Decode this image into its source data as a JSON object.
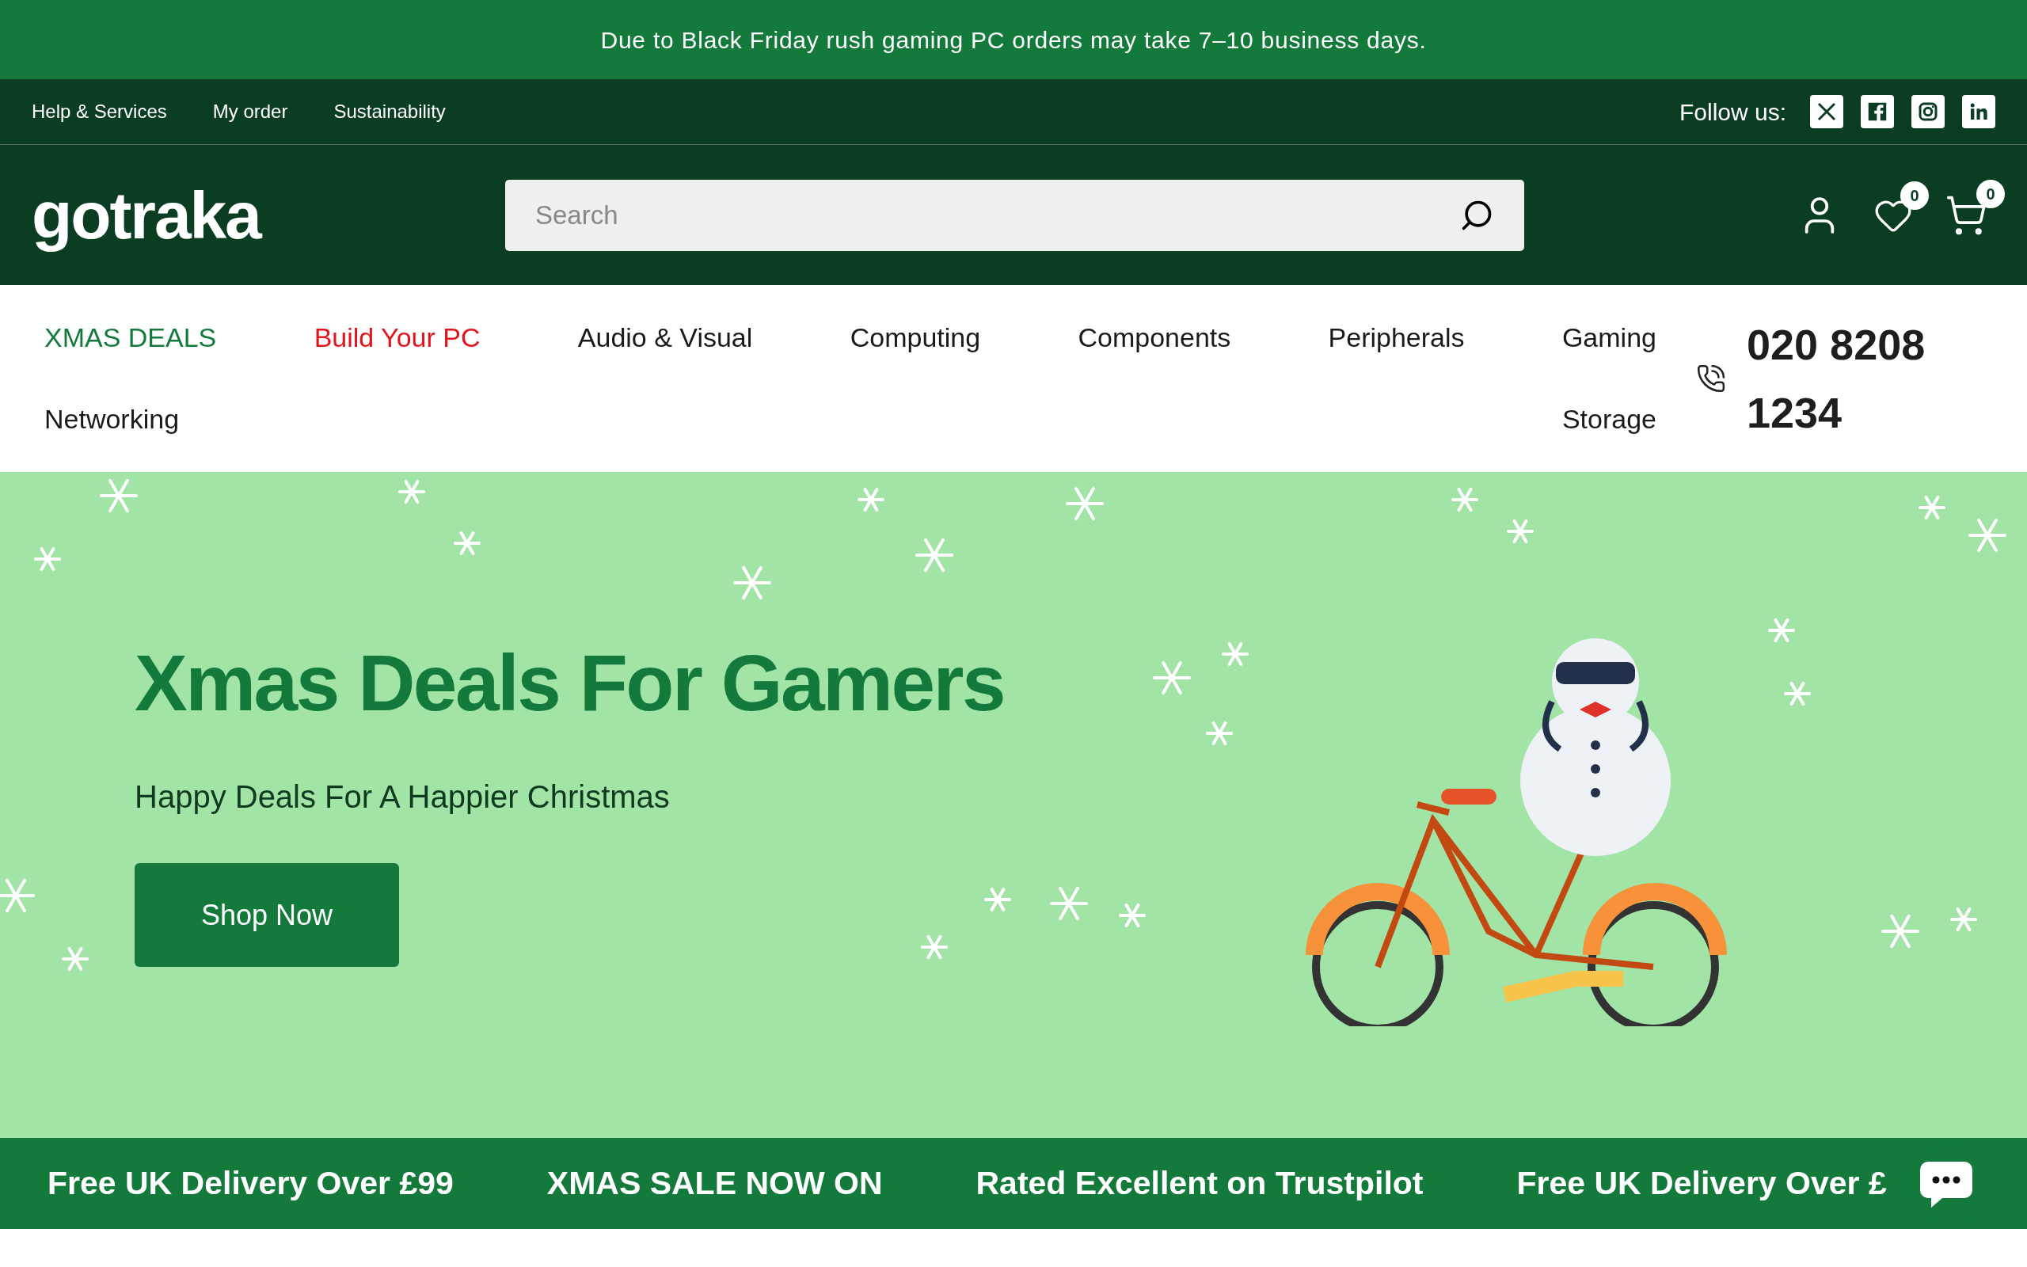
{
  "announcement": "Due to Black Friday rush gaming PC orders may take 7–10 business days.",
  "top_links": [
    "Help & Services",
    "My order",
    "Sustainability"
  ],
  "follow": {
    "label": "Follow us:"
  },
  "header": {
    "logo": "gotraka",
    "search": {
      "placeholder": "Search"
    },
    "wishlist_count": "0",
    "cart_count": "0"
  },
  "nav": {
    "items": [
      {
        "label": "XMAS DEALS",
        "color": "#137a3c"
      },
      {
        "label": "Build Your PC",
        "color": "#e3141b"
      },
      {
        "label": "Audio & Visual",
        "color": "#1a1a1a"
      },
      {
        "label": "Computing",
        "color": "#1a1a1a"
      },
      {
        "label": "Components",
        "color": "#1a1a1a"
      },
      {
        "label": "Peripherals",
        "color": "#1a1a1a"
      },
      {
        "label": "Gaming",
        "color": "#1a1a1a"
      },
      {
        "label": "Networking",
        "color": "#1a1a1a"
      },
      {
        "label": "Storage",
        "color": "#1a1a1a"
      }
    ],
    "phone": "020 8208 1234"
  },
  "hero": {
    "title": "Xmas Deals For Gamers",
    "subtitle": "Happy Deals For A Happier Christmas",
    "button": "Shop Now"
  },
  "ticker": [
    "Free UK Delivery Over £99",
    "XMAS SALE NOW ON",
    "Rated Excellent on Trustpilot",
    "Free UK Delivery Over £"
  ]
}
